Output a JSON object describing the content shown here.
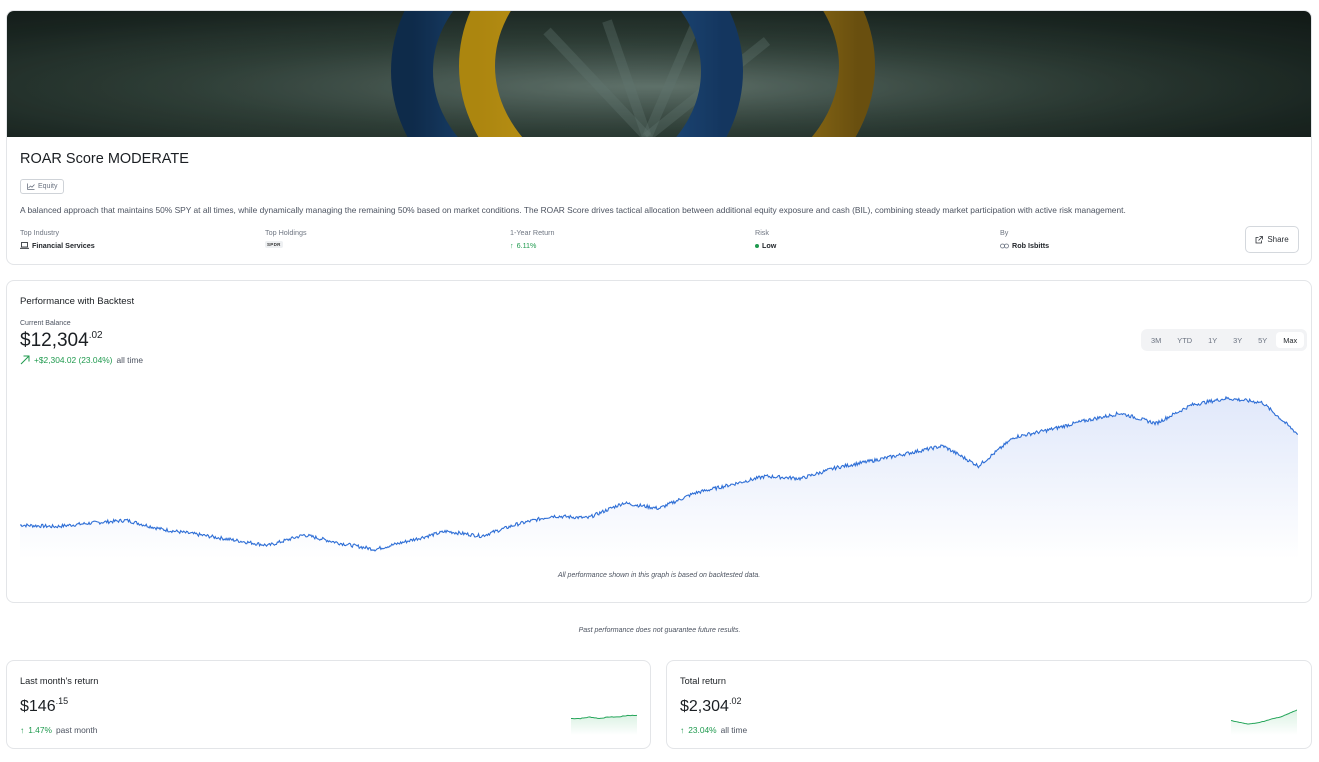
{
  "strategy": {
    "title": "ROAR Score MODERATE",
    "badge": "Equity",
    "description": "A balanced approach that maintains 50% SPY at all times, while dynamically managing the remaining 50% based on market conditions. The ROAR Score drives tactical allocation between additional equity exposure and cash (BIL), combining steady market participation with active risk management.",
    "stats": {
      "top_industry": {
        "label": "Top Industry",
        "value": "Financial Services"
      },
      "top_holdings": {
        "label": "Top Holdings",
        "value": "SPDR"
      },
      "one_year_return": {
        "label": "1-Year Return",
        "value": "6.11%"
      },
      "risk": {
        "label": "Risk",
        "value": "Low"
      },
      "by": {
        "label": "By",
        "value": "Rob Isbitts"
      }
    },
    "share_label": "Share"
  },
  "performance": {
    "title": "Performance with Backtest",
    "balance_label": "Current Balance",
    "balance_main": "$12,304",
    "balance_cents": ".02",
    "change_value": "+$2,304.02 (23.04%)",
    "change_period": "all time",
    "ranges": [
      "3M",
      "YTD",
      "1Y",
      "3Y",
      "5Y",
      "Max"
    ],
    "active_range": "Max",
    "disclaimer": "All performance shown in this graph is based on backtested data."
  },
  "past_performance_note": "Past performance does not guarantee future results.",
  "last_month": {
    "title": "Last month's return",
    "value_main": "$146",
    "value_cents": ".15",
    "change": "1.47%",
    "period": "past month"
  },
  "total_return": {
    "title": "Total return",
    "value_main": "$2,304",
    "value_cents": ".02",
    "change": "23.04%",
    "period": "all time"
  },
  "colors": {
    "line": "#2f6fd6",
    "area_top": "#e6ecfb",
    "positive": "#1f9a4e",
    "mini_line": "#25a55a"
  },
  "chart_data": [
    {
      "type": "area",
      "y_unit": "USD balance",
      "x": "time (backtest, oldest to newest)",
      "y": [
        10000,
        9960,
        10050,
        10120,
        9890,
        9760,
        9620,
        9480,
        9750,
        9540,
        9380,
        9610,
        9840,
        9720,
        10020,
        10230,
        10180,
        10560,
        10420,
        10810,
        11020,
        11240,
        11180,
        11460,
        11630,
        11820,
        12010,
        11500,
        12230,
        12420,
        12650,
        12840,
        12580,
        13050,
        13220,
        13110,
        12304
      ],
      "grid": false,
      "legend": "none"
    },
    {
      "type": "area",
      "name": "last-month-sparkline",
      "y": [
        0.5,
        0.5,
        0.51,
        0.5,
        0.51,
        0.51,
        0.52,
        0.52
      ],
      "grid": false,
      "legend": "none"
    },
    {
      "type": "area",
      "name": "total-return-sparkline",
      "y": [
        0.4,
        0.38,
        0.36,
        0.37,
        0.39,
        0.42,
        0.44,
        0.48,
        0.52
      ],
      "grid": false,
      "legend": "none"
    }
  ]
}
